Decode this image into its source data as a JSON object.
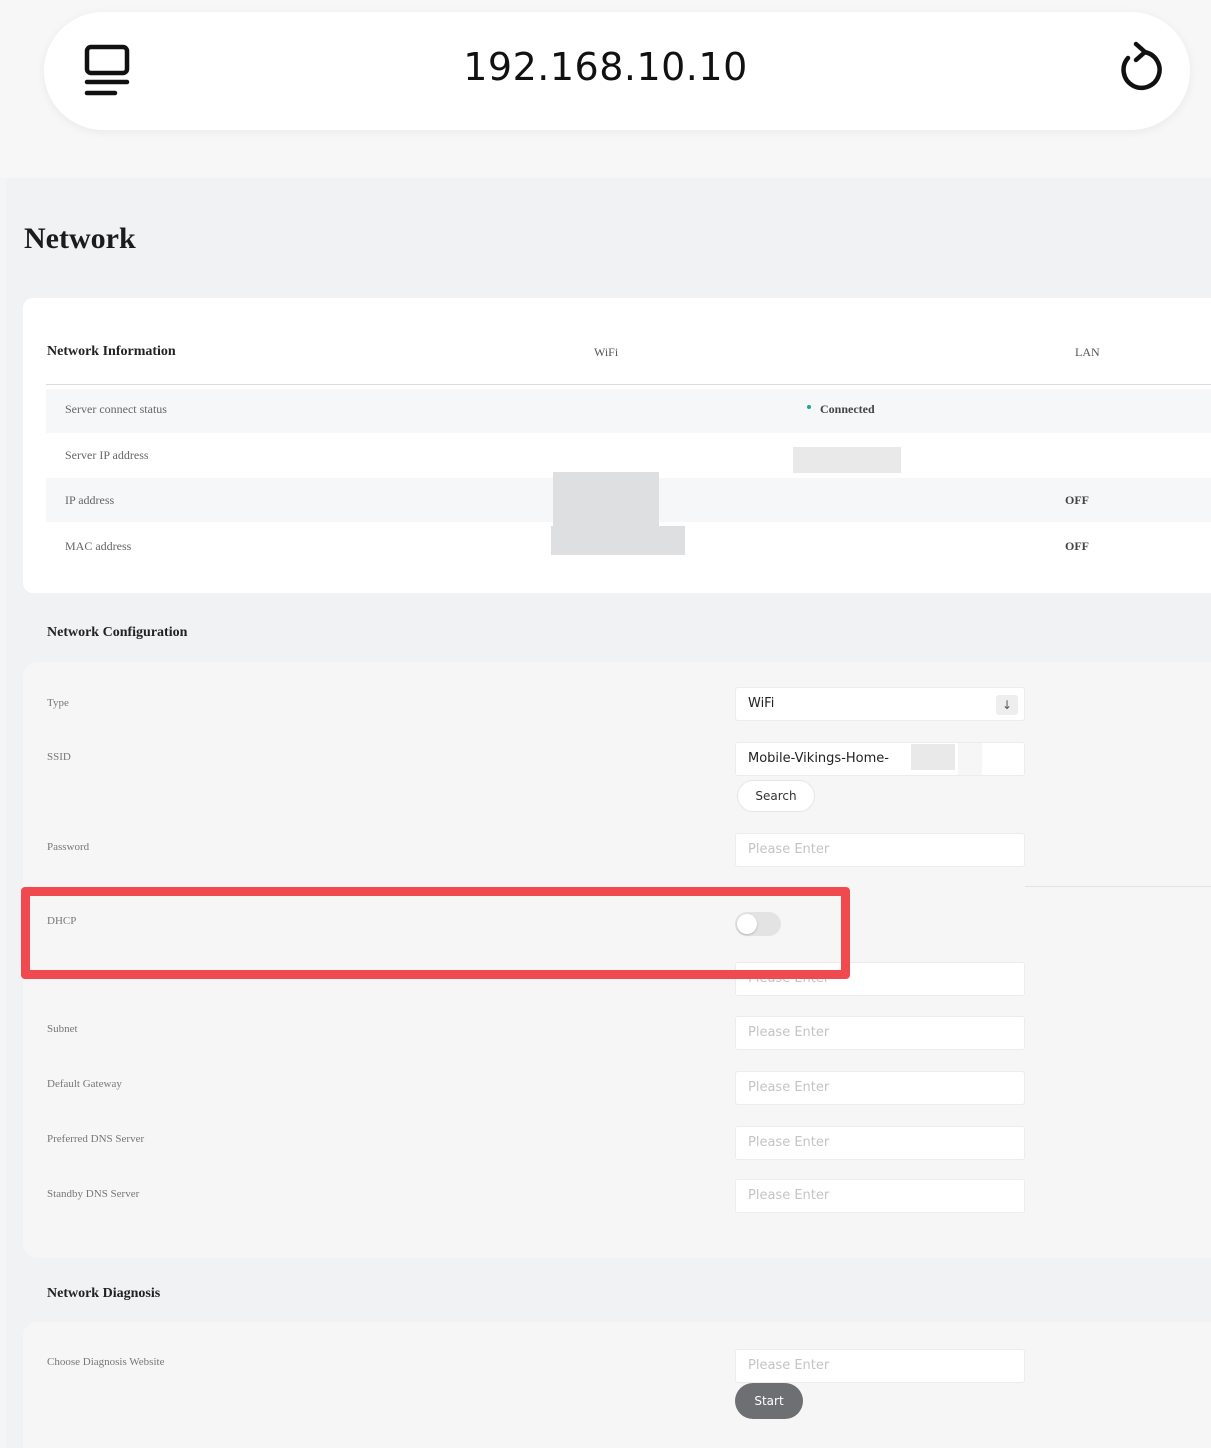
{
  "browser": {
    "url": "192.168.10.10",
    "tabs_icon": "tabs-icon",
    "reload_icon": "reload-icon"
  },
  "page": {
    "title": "Network"
  },
  "network_information": {
    "heading": "Network Information",
    "columns": [
      "WiFi",
      "LAN"
    ],
    "rows": [
      {
        "label": "Server connect status",
        "value": "Connected"
      },
      {
        "label": "Server IP address",
        "value": ""
      },
      {
        "label": "IP address",
        "wifi": "",
        "lan": "OFF"
      },
      {
        "label": "MAC address",
        "wifi": "",
        "lan": "OFF"
      }
    ],
    "status_color": "#1aa89a"
  },
  "network_configuration": {
    "heading": "Network Configuration",
    "type": {
      "label": "Type",
      "value": "WiFi"
    },
    "ssid": {
      "label": "SSID",
      "value": "Mobile-Vikings-Home-",
      "search_label": "Search"
    },
    "password": {
      "label": "Password",
      "placeholder": "Please Enter"
    },
    "dhcp": {
      "label": "DHCP",
      "enabled": false
    },
    "ip_address": {
      "placeholder": "Please Enter"
    },
    "subnet": {
      "label": "Subnet",
      "placeholder": "Please Enter"
    },
    "gateway": {
      "label": "Default Gateway",
      "placeholder": "Please Enter"
    },
    "preferred_dns": {
      "label": "Preferred DNS Server",
      "placeholder": "Please Enter"
    },
    "standby_dns": {
      "label": "Standby DNS Server",
      "placeholder": "Please Enter"
    },
    "highlight_color": "#f04a50"
  },
  "network_diagnosis": {
    "heading": "Network Diagnosis",
    "website": {
      "label": "Choose Diagnosis Website",
      "placeholder": "Please Enter"
    },
    "start_label": "Start"
  }
}
